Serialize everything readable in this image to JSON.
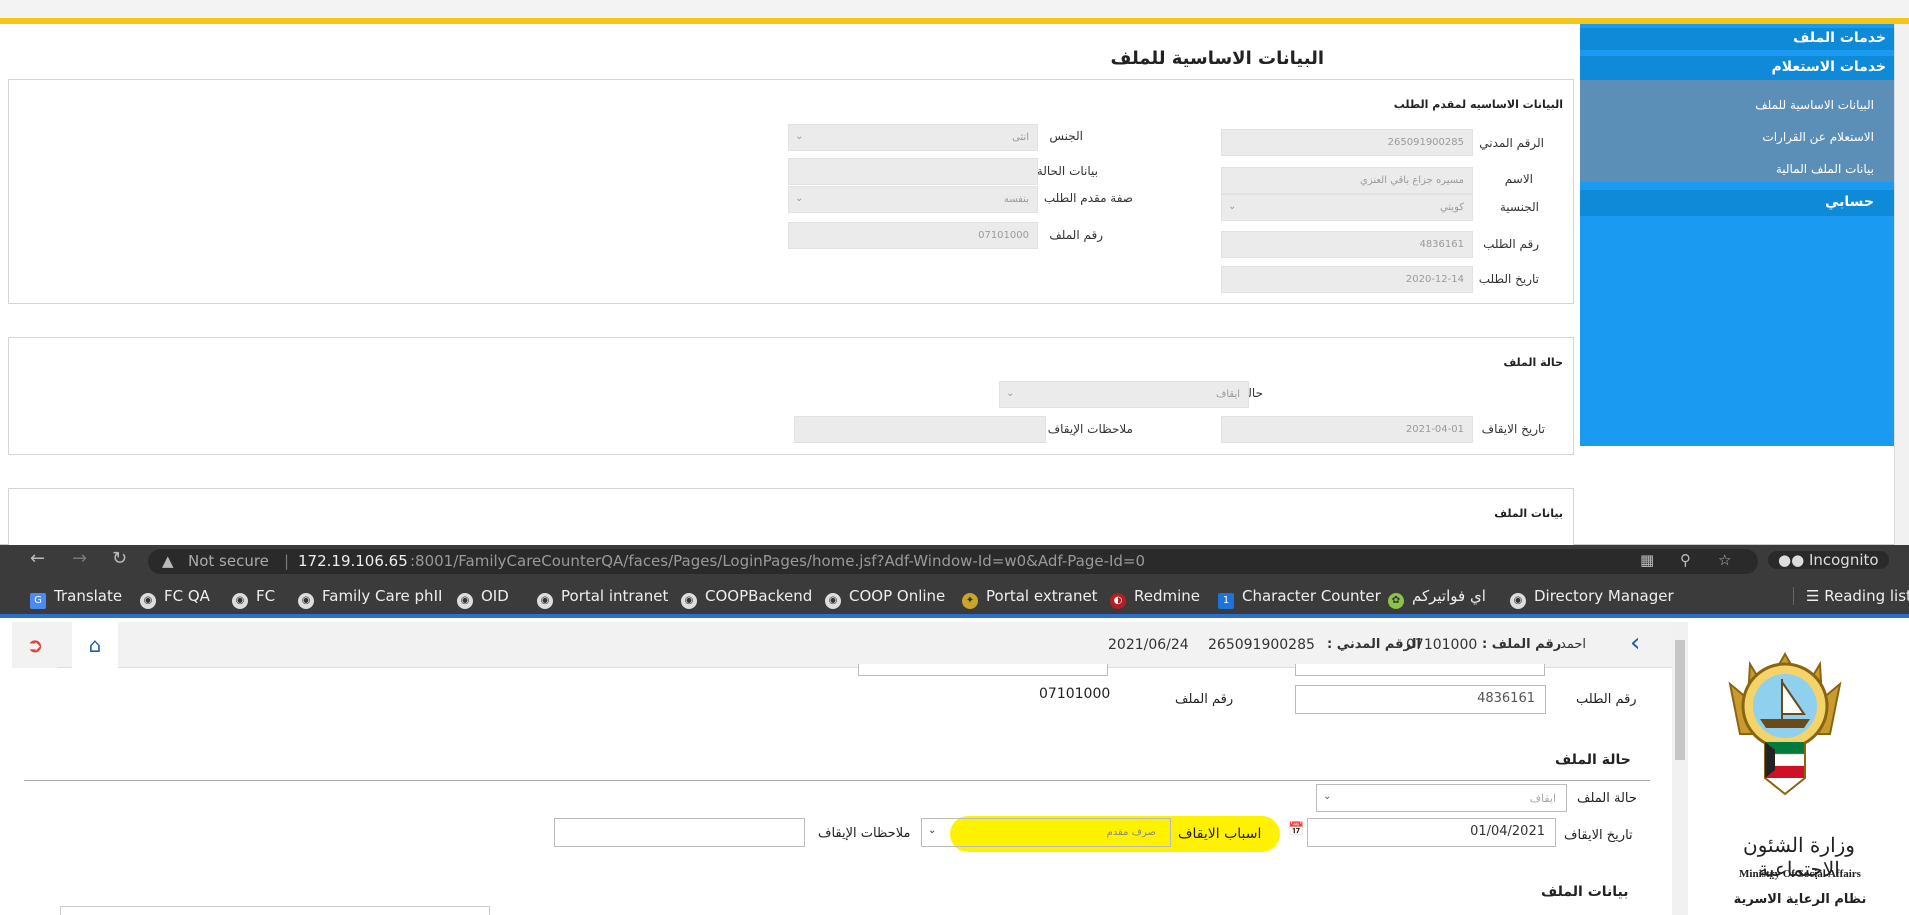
{
  "top": {
    "page_title": "البيانات الاساسية للملف",
    "sidebar": {
      "file_services": "خدمات الملف",
      "inquiry_services": "خدمات الاستعلام",
      "links": [
        "البيانات الاساسية للملف",
        "الاستعلام عن القرارات",
        "بيانات الملف المالية"
      ],
      "my_account": "حسابي"
    },
    "applicant_section": {
      "title": "البيانات الاساسيه لمقدم الطلب",
      "civil_id_label": "الرقم المدني",
      "civil_id_value": "265091900285",
      "name_label": "الاسم",
      "name_value": "مسيره جزاع باقي العنزي",
      "nationality_label": "الجنسية",
      "nationality_value": "كويتي",
      "request_no_label": "رقم الطلب",
      "request_no_value": "4836161",
      "request_date_label": "تاريخ الطلب",
      "request_date_value": "2020-12-14",
      "gender_label": "الجنس",
      "gender_value": "انثى",
      "case_data_label": "بيانات الحالة",
      "applicant_capacity_label": "صفة مقدم الطلب",
      "applicant_capacity_value": "بنفسه",
      "file_no_label": "رقم الملف",
      "file_no_value": "07101000"
    },
    "file_status_section": {
      "title": "حالة الملف",
      "request_status_label": "حالة الطلب",
      "request_status_value": "ايقاف",
      "stop_date_label": "تاريخ الايقاف",
      "stop_date_value": "2021-04-01",
      "stop_notes_label": "ملاحظات الإيقاف"
    },
    "file_data_section": {
      "title": "بيانات الملف"
    }
  },
  "browser": {
    "url_security": "Not secure",
    "url_host": "172.19.106.65",
    "url_rest": ":8001/FamilyCareCounterQA/faces/Pages/LoginPages/home.jsf?Adf-Window-Id=w0&Adf-Page-Id=0",
    "incognito": "Incognito",
    "bookmarks": [
      "Translate",
      "FC QA",
      "FC",
      "Family Care phII",
      "OID",
      "Portal intranet",
      "COOPBackend",
      "COOP Online",
      "Portal extranet",
      "Redmine",
      "Character Counter",
      "اي فواتيركم",
      "Directory Manager"
    ],
    "reading_list": "Reading list"
  },
  "bottom": {
    "header": {
      "user": "احمد",
      "file_no_label": "رقم الملف :",
      "file_no_value": "07101000",
      "civil_id_label": "الرقم المدني :",
      "civil_id_value": "265091900285",
      "date": "2021/06/24"
    },
    "request_no_label": "رقم الطلب",
    "request_no_value": "4836161",
    "file_no_label": "رقم الملف",
    "file_no_value": "07101000",
    "file_status_title": "حالة الملف",
    "file_status_label": "حالة الملف",
    "file_status_value": "ايقاف",
    "stop_date_label": "تاريخ الايقاف",
    "stop_date_value": "01/04/2021",
    "stop_reasons_label": "اسباب الايقاف",
    "stop_reasons_value": "صرف مقدم",
    "stop_notes_label": "ملاحظات الإيقاف",
    "file_data_title": "بيانات الملف",
    "ministry_ar": "وزارة الشئون الاجتماعية",
    "ministry_en": "Ministry Of Social Affairs",
    "system_name": "نظام الرعاية الاسرية",
    "highlight_color": "#fff200"
  }
}
